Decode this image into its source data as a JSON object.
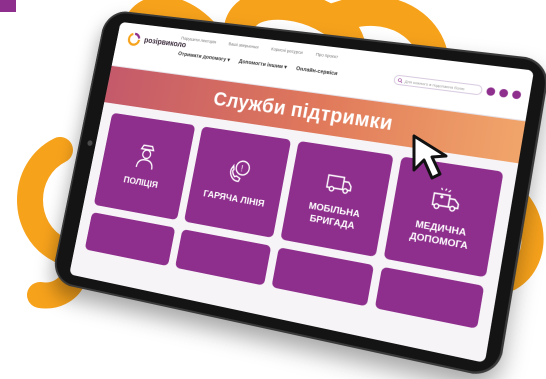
{
  "colors": {
    "brand_purple": "#8e2f8d",
    "accent_orange": "#f7a21b",
    "banner_start": "#c45a6a",
    "banner_end": "#f1a56a"
  },
  "site": {
    "logo_text": "розірвиколо",
    "top_links": [
      "Порушити лекторія",
      "Ваші звернення",
      "Корисні ресурси",
      "Про проєкт"
    ],
    "nav": [
      "Отримати допомогу ▾",
      "Допомогти іншим ▾",
      "Онлайн-сервіси"
    ],
    "search_placeholder": "Для кожного в подолання болю"
  },
  "banner": {
    "title": "Служби підтримки"
  },
  "tiles": [
    {
      "label": "ПОЛІЦІЯ",
      "icon": "police-officer-icon"
    },
    {
      "label": "ГАРЯЧА ЛІНІЯ",
      "icon": "phone-hotline-icon"
    },
    {
      "label": "МОБІЛЬНА БРИГАДА",
      "icon": "van-icon"
    },
    {
      "label": "МЕДИЧНА ДОПОМОГА",
      "icon": "ambulance-icon"
    }
  ]
}
